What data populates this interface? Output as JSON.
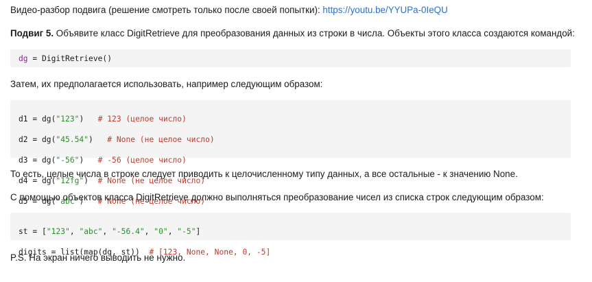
{
  "intro": {
    "text": "Видео-разбор подвига (решение смотреть только после своей попытки): ",
    "link": "https://youtu.be/YYUPa-0IeQU"
  },
  "task": {
    "label": "Подвиг 5.",
    "text": " Объявите класс DigitRetrieve для преобразования данных из строки в числа. Объекты этого класса создаются командой:"
  },
  "code1": {
    "var": "dg",
    "rest": " = DigitRetrieve()"
  },
  "para_usage": "Затем, их предполагается использовать, например следующим образом:",
  "code2": [
    {
      "lhs": "d1 = dg(",
      "str": "\"123\"",
      "mid": ")   ",
      "comment": "# 123 (целое число)"
    },
    {
      "lhs": "d2 = dg(",
      "str": "\"45.54\"",
      "mid": ")   ",
      "comment": "# None (не целое число)"
    },
    {
      "lhs": "d3 = dg(",
      "str": "\"-56\"",
      "mid": ")   ",
      "comment": "# -56 (целое число)"
    },
    {
      "lhs": "d4 = dg(",
      "str": "\"12fg\"",
      "mid": ")  ",
      "comment": "# None (не целое число)"
    },
    {
      "lhs": "d5 = dg(",
      "str": "\"abc\"",
      "mid": ")   ",
      "comment": "# None (не целое число)"
    }
  ],
  "para_int": "То есть, целые числа в строке следует приводить к целочисленному типу данных, а все остальные - к значению None.",
  "para_list": "С помощью объектов класса DigitRetrieve должно выполняться преобразование чисел из списка строк следующим образом:",
  "code3": {
    "line1": {
      "a": "st = [",
      "s1": "\"123\"",
      "s2": "\"abc\"",
      "s3": "\"-56.4\"",
      "s4": "\"0\"",
      "s5": "\"-5\"",
      "sep": ", ",
      "end": "]"
    },
    "line2": {
      "a": "digits = list(map(dg, st))  ",
      "comment": "# [123, None, None, 0, -5]"
    }
  },
  "ps": "P.S. На экран ничего выводить не нужно."
}
